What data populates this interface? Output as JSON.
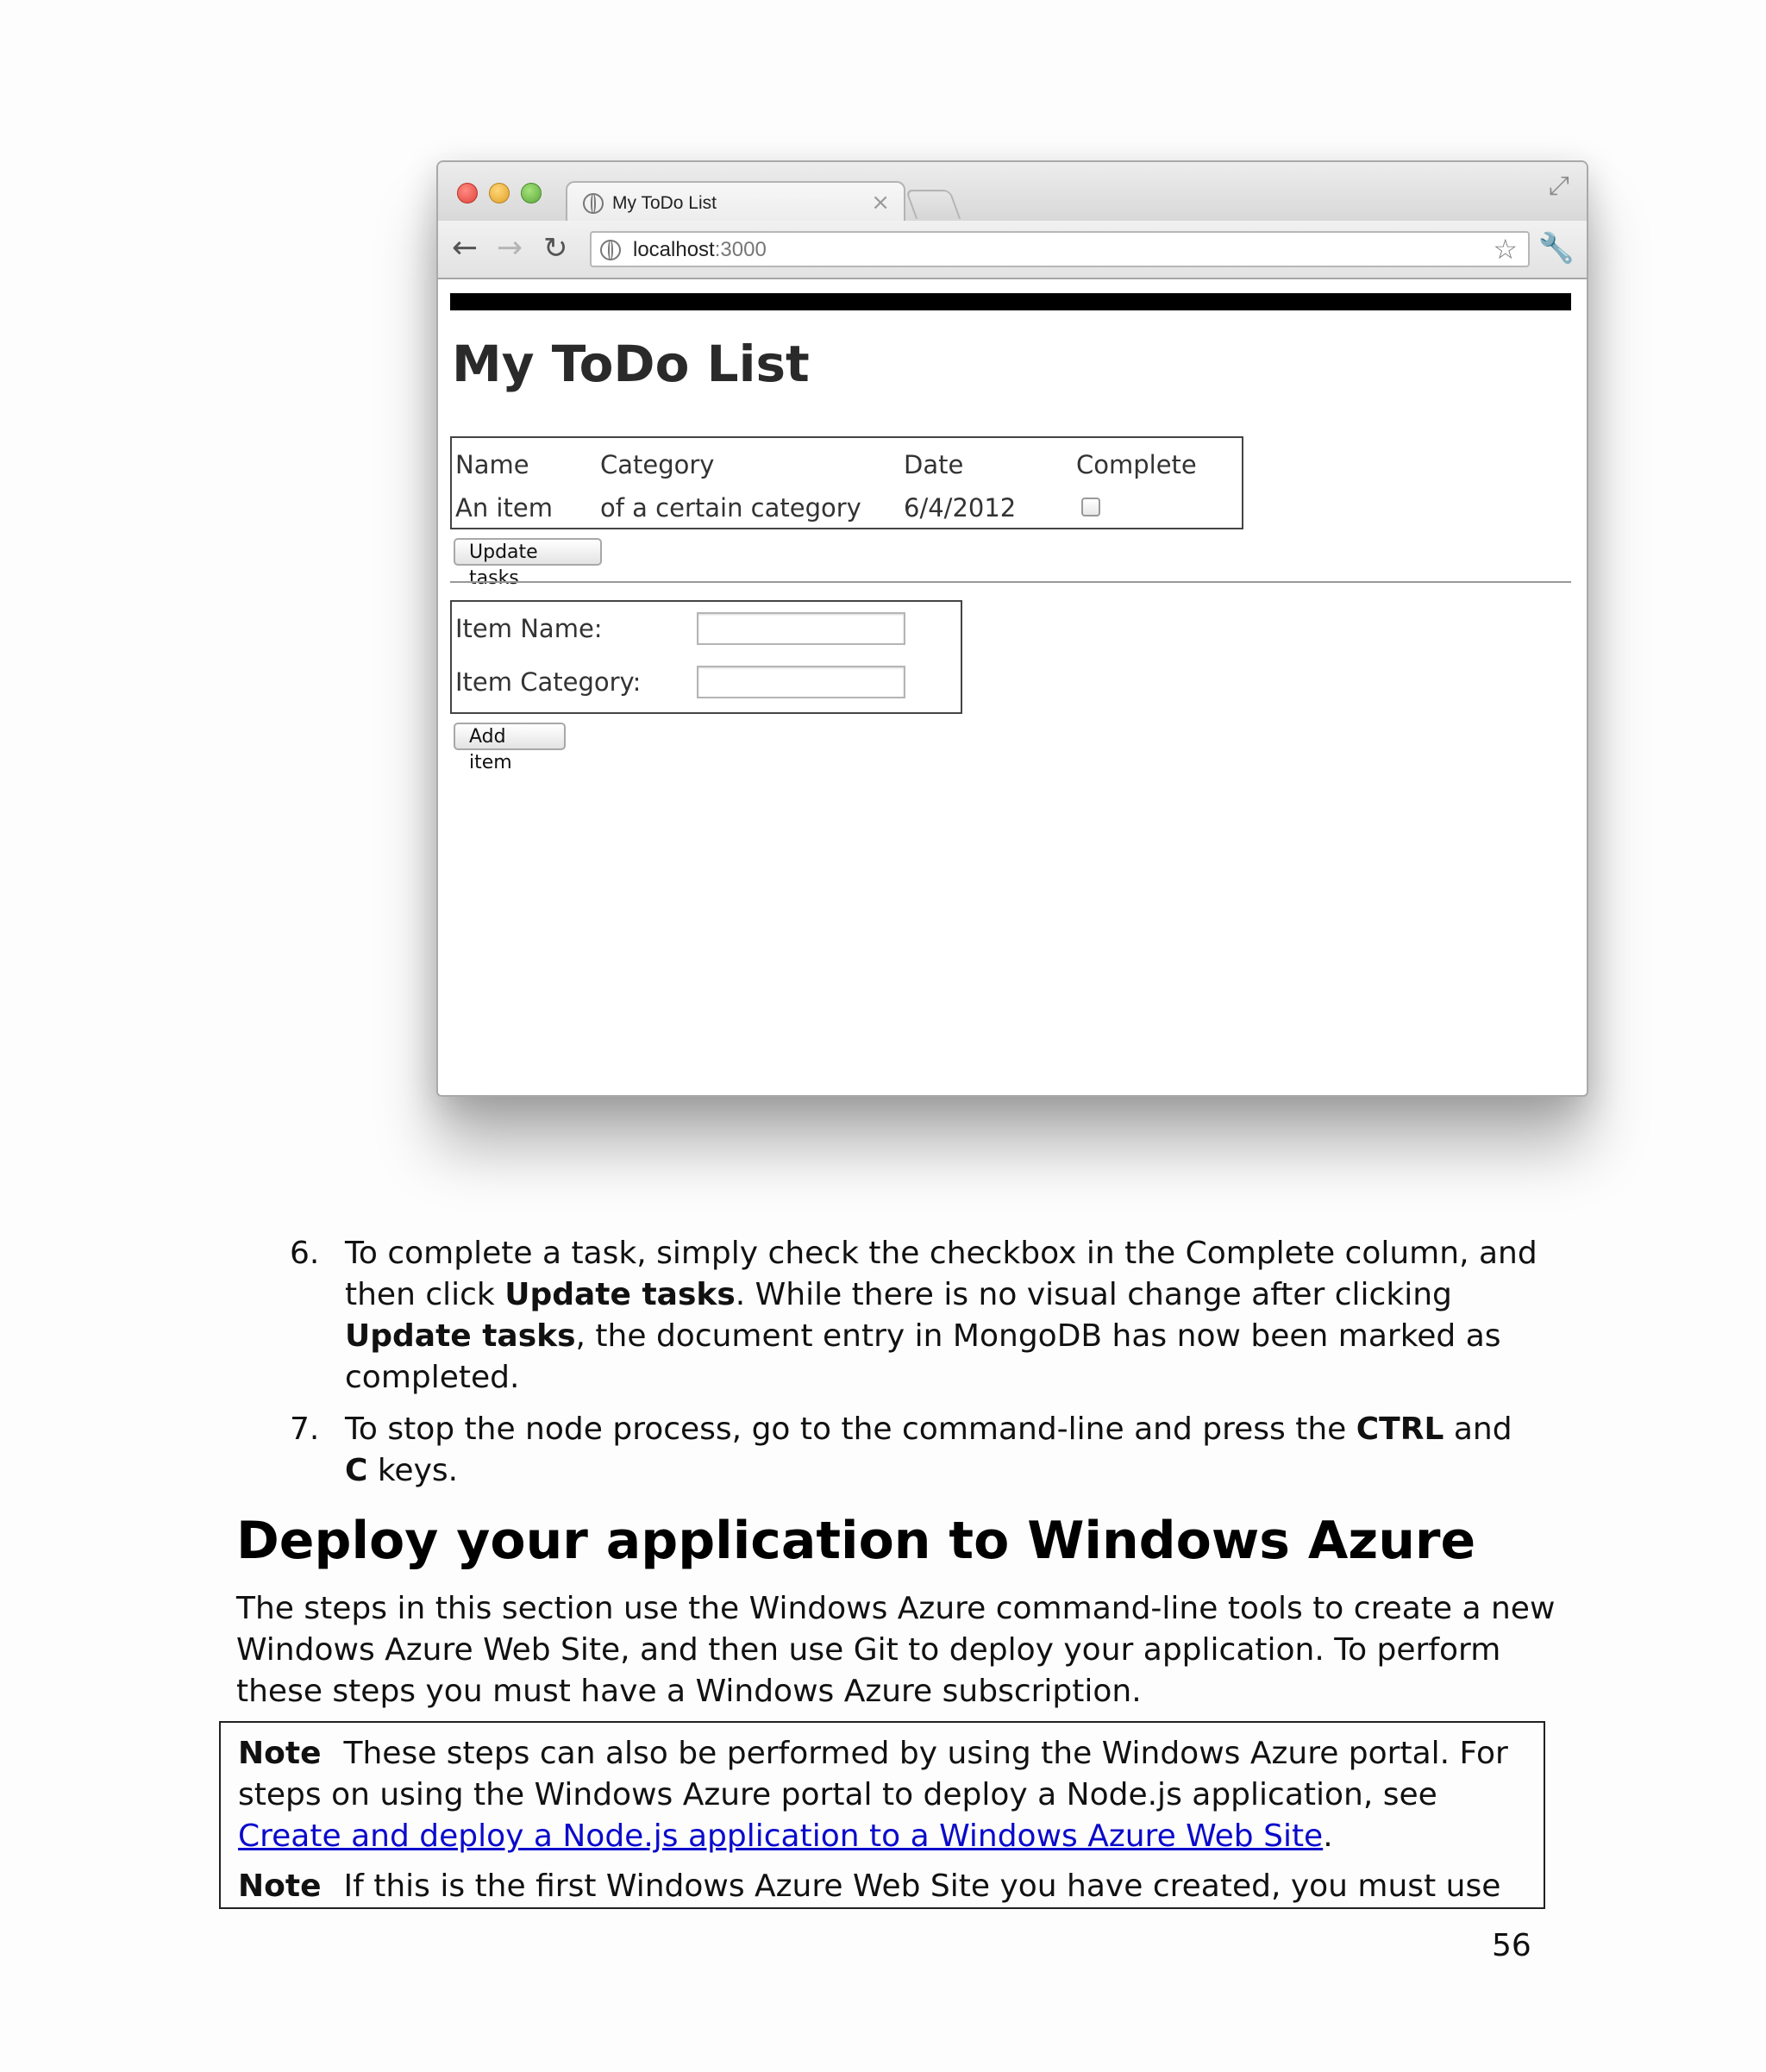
{
  "browser": {
    "tab_title": "My ToDo List",
    "tab_close": "×",
    "url_host": "localhost",
    "url_port": ":3000",
    "page": {
      "heading": "My ToDo List",
      "table_headers": [
        "Name",
        "Category",
        "Date",
        "Complete"
      ],
      "rows": [
        {
          "name": "An item",
          "category": "of a certain category",
          "date": "6/4/2012",
          "complete": false
        }
      ],
      "update_button": "Update tasks",
      "item_name_label": "Item Name:",
      "item_category_label": "Item Category:",
      "add_button": "Add item"
    }
  },
  "steps": [
    {
      "number": "6.",
      "t1": "To complete a task, simply check the checkbox in the Complete column, and then click ",
      "b1": "Update tasks",
      "t2": ". While there is no visual change after clicking ",
      "b2": "Update tasks",
      "t3": ", the document entry in MongoDB has now been marked as completed."
    },
    {
      "number": "7.",
      "t1": "To stop the node process, go to the command-line and press the ",
      "b1": "CTRL",
      "t2": " and ",
      "b2": "C",
      "t3": " keys."
    }
  ],
  "section": {
    "heading": "Deploy your application to Windows Azure",
    "intro": "The steps in this section use the Windows Azure command-line tools to create a new Windows Azure Web Site, and then use Git to deploy your application. To perform these steps you must have a Windows Azure subscription."
  },
  "notes": [
    {
      "label": "Note",
      "text": "These steps can also be performed by using the Windows Azure portal. For steps on using the Windows Azure portal to deploy a Node.js application, see ",
      "link": "Create and deploy a Node.js application to a Windows Azure Web Site",
      "after": "."
    },
    {
      "label": "Note",
      "text": "If this is the first Windows Azure Web Site you have created, you must use the"
    }
  ],
  "page_number": "56",
  "colors": {
    "link": "#0a0acc",
    "heading": "#000000"
  }
}
